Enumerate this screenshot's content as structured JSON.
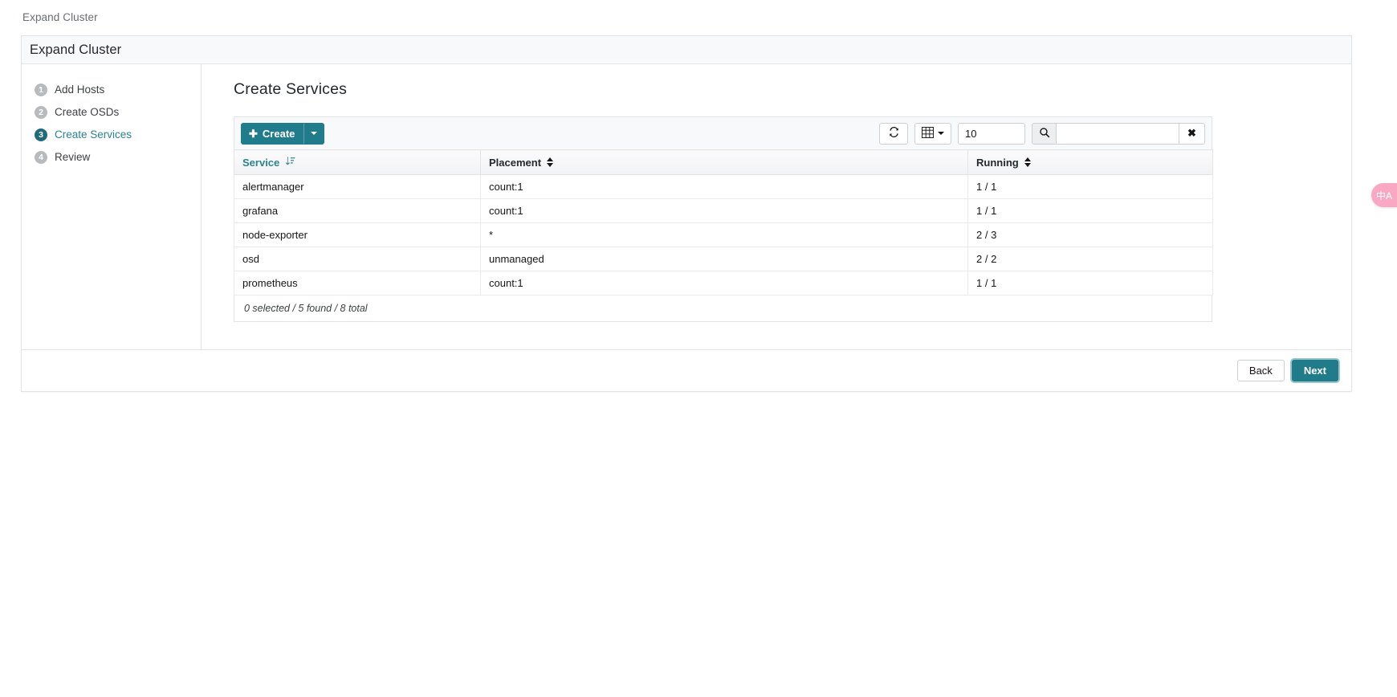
{
  "breadcrumb": {
    "text": "Expand Cluster"
  },
  "wizard": {
    "title": "Expand Cluster",
    "steps": [
      {
        "number": "1",
        "label": "Add Hosts",
        "active": false
      },
      {
        "number": "2",
        "label": "Create OSDs",
        "active": false
      },
      {
        "number": "3",
        "label": "Create Services",
        "active": true
      },
      {
        "number": "4",
        "label": "Review",
        "active": false
      }
    ],
    "footer": {
      "back_label": "Back",
      "next_label": "Next"
    }
  },
  "content": {
    "heading": "Create Services"
  },
  "toolbar": {
    "create_label": "Create",
    "plus_icon": "plus-icon",
    "create_caret_icon": "chevron-down-icon",
    "refresh_icon": "refresh-icon",
    "columns_icon": "table-columns-icon",
    "columns_caret_icon": "chevron-down-icon",
    "limit_value": "10",
    "search_icon": "search-icon",
    "search_value": "",
    "search_placeholder": "",
    "clear_icon": "close-icon",
    "clear_label": "✖"
  },
  "table": {
    "columns": [
      {
        "label": "Service",
        "sorted": true,
        "sort_icon": "sort-amount-asc-icon"
      },
      {
        "label": "Placement",
        "sorted": false,
        "sort_icon": "sort-icon"
      },
      {
        "label": "Running",
        "sorted": false,
        "sort_icon": "sort-icon"
      }
    ],
    "rows": [
      {
        "service": "alertmanager",
        "placement": "count:1",
        "running": "1 / 1"
      },
      {
        "service": "grafana",
        "placement": "count:1",
        "running": "1 / 1"
      },
      {
        "service": "node-exporter",
        "placement": "*",
        "running": "2 / 3"
      },
      {
        "service": "osd",
        "placement": "unmanaged",
        "running": "2 / 2"
      },
      {
        "service": "prometheus",
        "placement": "count:1",
        "running": "1 / 1"
      }
    ],
    "footer_status": "0 selected / 5 found / 8 total"
  },
  "widgets": {
    "translate_label": "中A",
    "translate_icon": "translate-icon"
  },
  "colors": {
    "accent_teal": "#207b8b",
    "step_active": "#1f6b77",
    "link_teal": "#2b8290",
    "translate_pink": "#f9a8c4"
  }
}
